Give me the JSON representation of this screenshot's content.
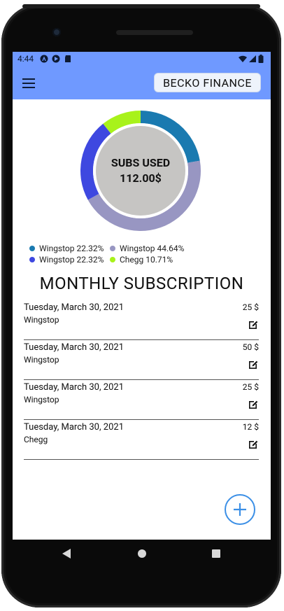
{
  "status_bar": {
    "time": "4:44"
  },
  "app_bar": {
    "brand_label": "BECKO FINANCE"
  },
  "summary": {
    "center_title": "SUBS USED",
    "center_total": "112.00$",
    "segments": [
      {
        "color": "#1a7ab0",
        "fraction": 0.2232
      },
      {
        "color": "#9896c2",
        "fraction": 0.4464
      },
      {
        "color": "#3e48e0",
        "fraction": 0.2232
      },
      {
        "color": "#a8f21a",
        "fraction": 0.1071
      }
    ]
  },
  "legend": [
    {
      "label": "Wingstop 22.32%",
      "color": "#1a7ab0"
    },
    {
      "label": "Wingstop 44.64%",
      "color": "#9896c2"
    },
    {
      "label": "Wingstop 22.32%",
      "color": "#3e48e0"
    },
    {
      "label": "Chegg 10.71%",
      "color": "#a8f21a"
    }
  ],
  "section_title": "MONTHLY SUBSCRIPTION",
  "transactions": [
    {
      "date": "Tuesday, March 30, 2021",
      "name": "Wingstop",
      "amount": "25 $"
    },
    {
      "date": "Tuesday, March 30, 2021",
      "name": "Wingstop",
      "amount": "50 $"
    },
    {
      "date": "Tuesday, March 30, 2021",
      "name": "Wingstop",
      "amount": "25 $"
    },
    {
      "date": "Tuesday, March 30, 2021",
      "name": "Chegg",
      "amount": "12 $"
    }
  ],
  "icons": {
    "menu": "hamburger-menu-icon",
    "edit": "edit-icon",
    "add": "plus-icon",
    "back": "back-triangle-icon",
    "home": "home-circle-icon",
    "recents": "recents-square-icon"
  },
  "colors": {
    "app_bar": "#6f99ff",
    "fab_accent": "#3b8fe6",
    "donut_center": "#c6c5c3"
  }
}
